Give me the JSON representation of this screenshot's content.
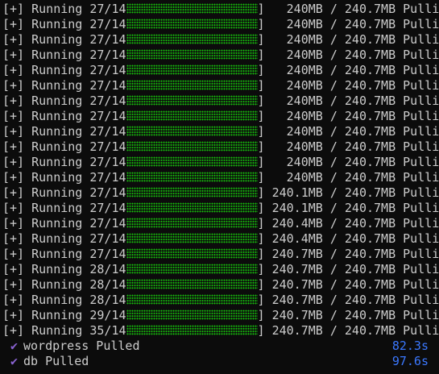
{
  "colors": {
    "background": "#0c0c0c",
    "text": "#cccccc",
    "progress": "#16c60c",
    "check": "#8a63d2",
    "time": "#3b78ff"
  },
  "prefix": "[+]",
  "status": "Running",
  "total": "240.7MB",
  "action": "Pulli",
  "rows": [
    {
      "count": "27/14",
      "size": "240MB"
    },
    {
      "count": "27/14",
      "size": "240MB"
    },
    {
      "count": "27/14",
      "size": "240MB"
    },
    {
      "count": "27/14",
      "size": "240MB"
    },
    {
      "count": "27/14",
      "size": "240MB"
    },
    {
      "count": "27/14",
      "size": "240MB"
    },
    {
      "count": "27/14",
      "size": "240MB"
    },
    {
      "count": "27/14",
      "size": "240MB"
    },
    {
      "count": "27/14",
      "size": "240MB"
    },
    {
      "count": "27/14",
      "size": "240MB"
    },
    {
      "count": "27/14",
      "size": "240MB"
    },
    {
      "count": "27/14",
      "size": "240MB"
    },
    {
      "count": "27/14",
      "size": "240MB"
    },
    {
      "count": "27/14",
      "size": "240.1MB"
    },
    {
      "count": "27/14",
      "size": "240.1MB"
    },
    {
      "count": "27/14",
      "size": "240.4MB"
    },
    {
      "count": "27/14",
      "size": "240.4MB"
    },
    {
      "count": "27/14",
      "size": "240.7MB"
    },
    {
      "count": "28/14",
      "size": "240.7MB"
    },
    {
      "count": "28/14",
      "size": "240.7MB"
    },
    {
      "count": "28/14",
      "size": "240.7MB"
    },
    {
      "count": "29/14",
      "size": "240.7MB"
    },
    {
      "count": "35/14",
      "size": "240.7MB"
    }
  ],
  "done": [
    {
      "icon": "check-icon",
      "label": "wordpress Pulled",
      "time": "82.3s"
    },
    {
      "icon": "check-icon",
      "label": "db Pulled",
      "time": "97.6s"
    }
  ]
}
